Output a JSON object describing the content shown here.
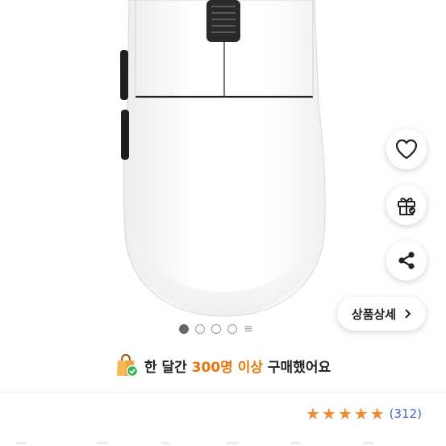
{
  "detail_button": {
    "label": "상품상세",
    "chevron": "chevron-right-icon"
  },
  "purchase_banner": {
    "icon": "shopping-bag-check-icon",
    "prefix": "한 달간 ",
    "highlight": "300명 이상",
    "suffix": " 구매했어요",
    "highlight_color": "#e8760a"
  },
  "rating": {
    "stars": 5,
    "star_color": "#f28a2e",
    "count": "(312)"
  },
  "carousel": {
    "total_dots": 4,
    "active_index": 0
  },
  "side_buttons": [
    "heart-icon",
    "gift-icon",
    "share-icon"
  ]
}
